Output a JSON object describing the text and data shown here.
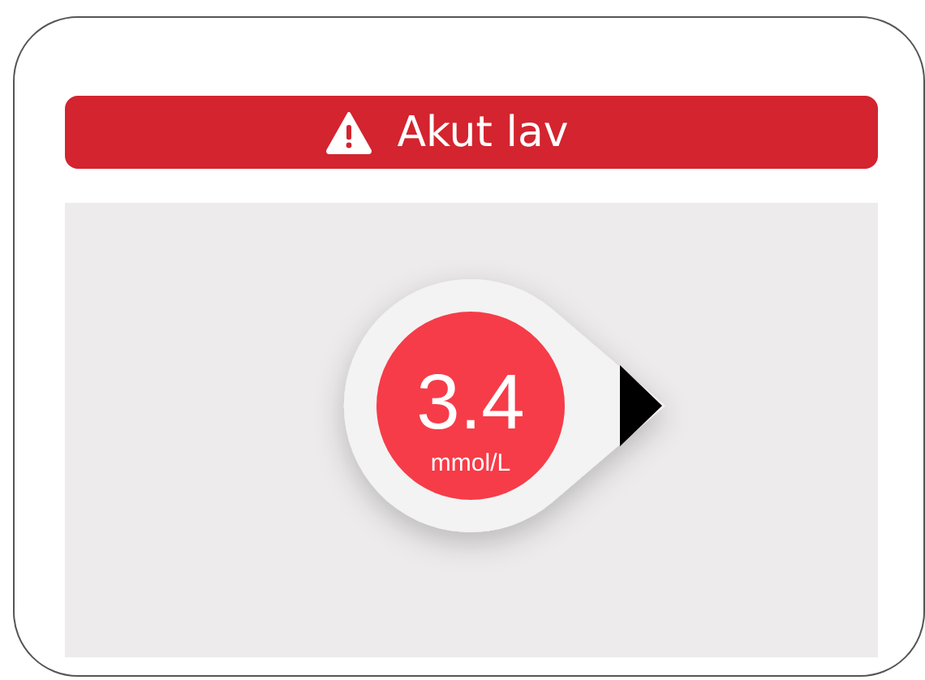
{
  "alert": {
    "kind": "urgent",
    "label": "Akut lav"
  },
  "reading": {
    "value": "3.4",
    "unit": "mmol/L",
    "trend_arrow": {
      "kind": "flat"
    }
  }
}
